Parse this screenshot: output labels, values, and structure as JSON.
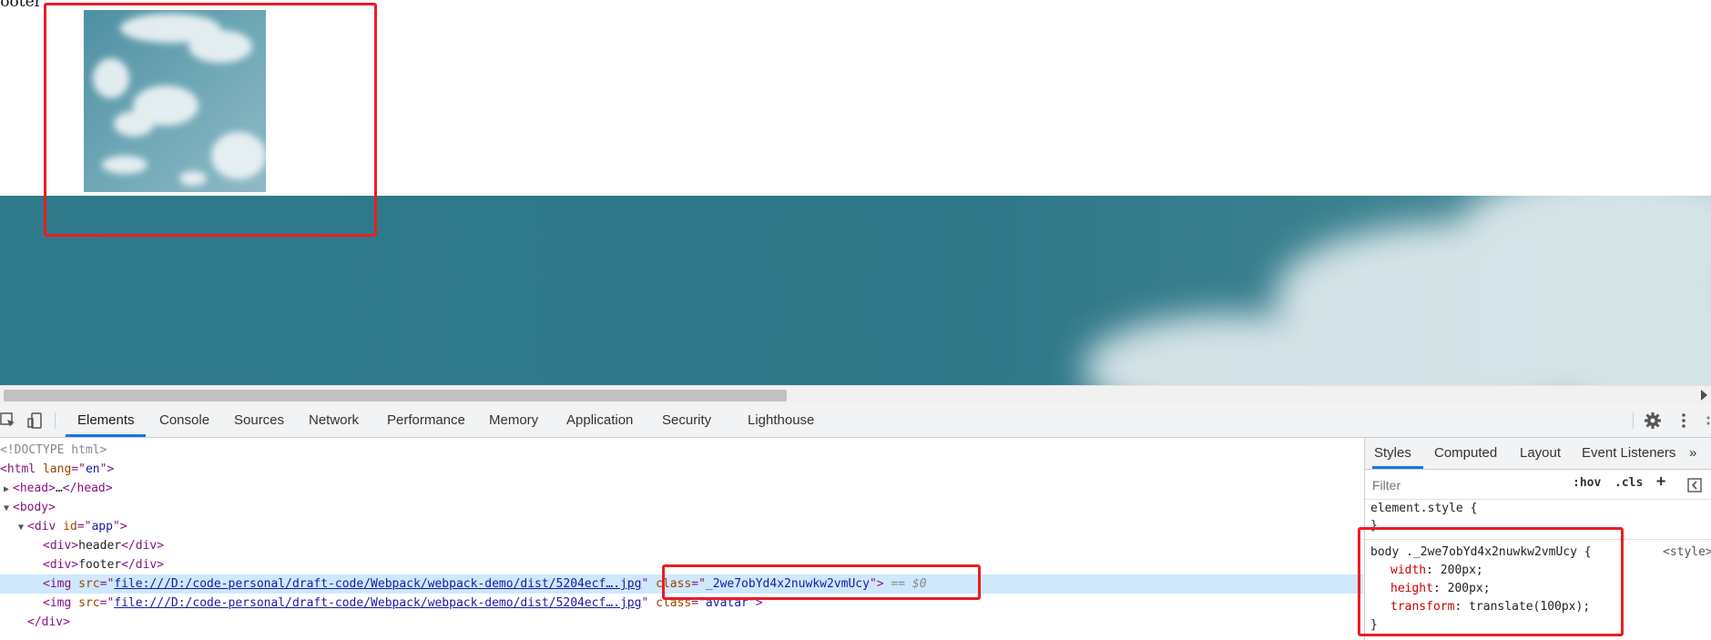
{
  "page": {
    "footer_text": "footer"
  },
  "devtools": {
    "tabs": [
      "Elements",
      "Console",
      "Sources",
      "Network",
      "Performance",
      "Memory",
      "Application",
      "Security",
      "Lighthouse"
    ],
    "active_tab": "Elements",
    "dom": {
      "doctype": "<!DOCTYPE html>",
      "html_open": "html",
      "html_lang_attr": "lang",
      "html_lang_val": "en",
      "head_collapsed": "head",
      "head_ellipsis": "…",
      "body_open": "body",
      "div_app": "div",
      "div_app_attr": "id",
      "div_app_val": "app",
      "header_text": "header",
      "footer_text": "footer",
      "img_tag": "img",
      "src_attr": "src",
      "img1_src": "file:///D:/code-personal/draft-code/Webpack/webpack-demo/dist/5204ecf….jpg",
      "img1_class_attr": "class",
      "img1_class": "_2we7obYd4x2nuwkw2vmUcy",
      "img1_suffix": "== $0",
      "img2_src": "file:///D:/code-personal/draft-code/Webpack/webpack-demo/dist/5204ecf….jpg",
      "img2_class_attr": "class",
      "img2_class": "avatar",
      "div_close": "div"
    },
    "styles": {
      "tabs": [
        "Styles",
        "Computed",
        "Layout",
        "Event Listeners"
      ],
      "active_tab": "Styles",
      "more_tabs": "»",
      "filter_placeholder": "Filter",
      "hov": ":hov",
      "cls": ".cls",
      "add": "+",
      "element_style": "element.style {",
      "close_brace": "}",
      "rule_selector": "body ._2we7obYd4x2nuwkw2vmUcy {",
      "rule_source": "<style>",
      "props": [
        {
          "name": "width",
          "value": "200px;"
        },
        {
          "name": "height",
          "value": "200px;"
        },
        {
          "name": "transform",
          "value": "translate(100px);"
        }
      ]
    }
  },
  "colors": {
    "highlight_border": "#ec1c24",
    "accent": "#1a73e8",
    "selected_row": "#cfe8fc"
  }
}
